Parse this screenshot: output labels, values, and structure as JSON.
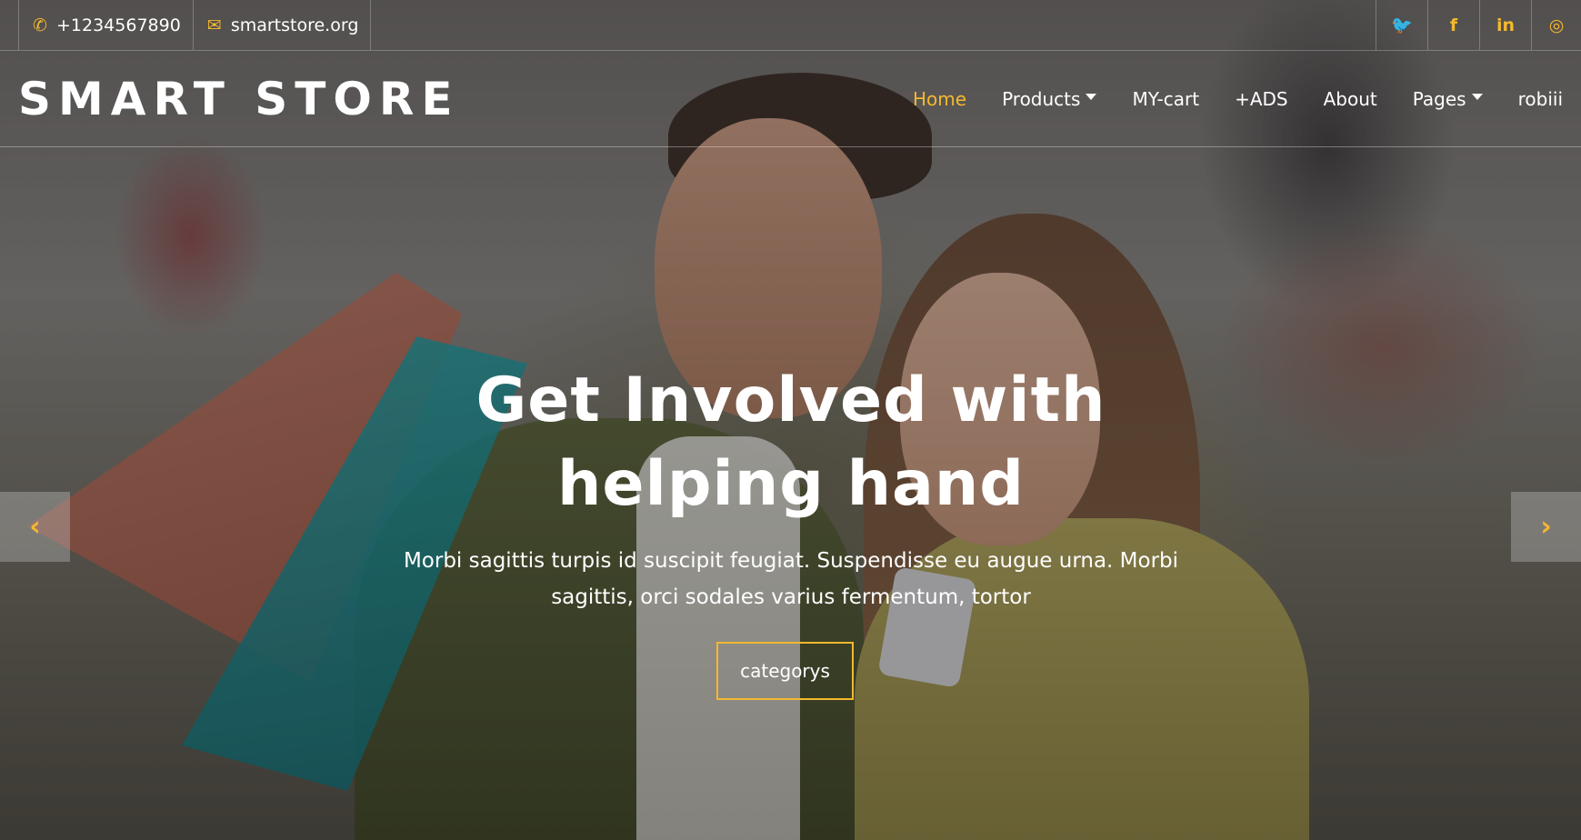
{
  "topbar": {
    "phone": "+1234567890",
    "email": "smartstore.org",
    "social": [
      {
        "icon": "twitter-icon",
        "glyph": "🐦"
      },
      {
        "icon": "facebook-icon",
        "glyph": "f"
      },
      {
        "icon": "linkedin-icon",
        "glyph": "in"
      },
      {
        "icon": "instagram-icon",
        "glyph": "◎"
      }
    ]
  },
  "navbar": {
    "brand": "SMART STORE",
    "items": [
      {
        "label": "Home",
        "active": true
      },
      {
        "label": "Products",
        "dropdown": true
      },
      {
        "label": "MY-cart"
      },
      {
        "label": "+ADS"
      },
      {
        "label": "About"
      },
      {
        "label": "Pages",
        "dropdown": true
      },
      {
        "label": "robiii"
      }
    ]
  },
  "hero": {
    "title_line1": "Get Involved with",
    "title_line2": "helping hand",
    "text": "Morbi sagittis turpis id suscipit feugiat. Suspendisse eu augue urna. Morbi sagittis, orci sodales varius fermentum, tortor",
    "button_label": "categorys"
  },
  "carousel": {
    "prev_glyph": "‹",
    "next_glyph": "›"
  },
  "colors": {
    "accent": "#f5b82e",
    "text": "#ffffff"
  }
}
